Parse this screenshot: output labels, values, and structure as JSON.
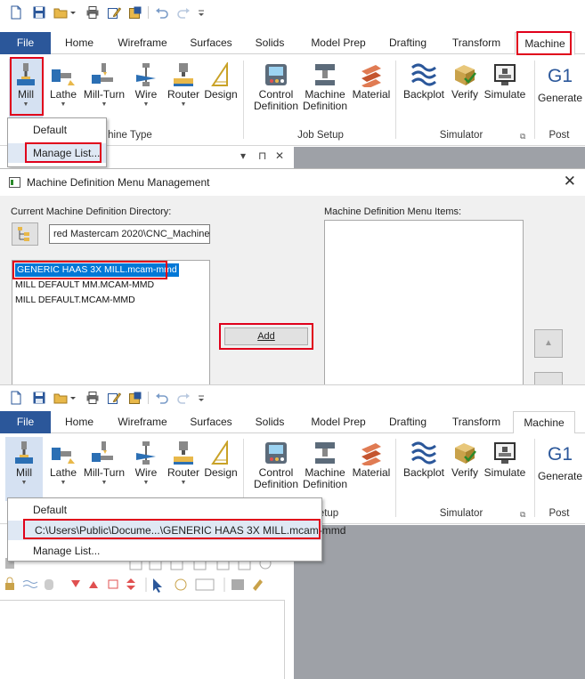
{
  "qat_icons": [
    "new-file-icon",
    "save-icon",
    "open-folder-icon",
    "dropdown-arrow-icon",
    "print-icon",
    "edit-icon",
    "save-as-icon",
    "undo-icon",
    "redo-icon",
    "customize-icon"
  ],
  "tabs": {
    "file": "File",
    "home": "Home",
    "wireframe": "Wireframe",
    "surfaces": "Surfaces",
    "solids": "Solids",
    "model_prep": "Model Prep",
    "drafting": "Drafting",
    "transform": "Transform",
    "machine": "Machine"
  },
  "ribbon": {
    "mill": "Mill",
    "lathe": "Lathe",
    "mill_turn": "Mill-Turn",
    "wire": "Wire",
    "router": "Router",
    "design": "Design",
    "control_line1": "Control",
    "control_line2": "Definition",
    "machine_line1": "Machine",
    "machine_line2": "Definition",
    "material": "Material",
    "backplot": "Backplot",
    "verify": "Verify",
    "simulate": "Simulate",
    "g1": "G1",
    "generate": "Generate"
  },
  "groups": {
    "machine_type": "Machine Type",
    "machine_type_partial": "hine Type",
    "job_setup": "Job Setup",
    "job_setup_partial": "etup",
    "simulator": "Simulator",
    "post": "Post"
  },
  "dropdown_top": {
    "default": "Default",
    "manage": "Manage List..."
  },
  "dropdown_bottom": {
    "default": "Default",
    "recent_path": "C:\\Users\\Public\\Docume...\\GENERIC HAAS 3X MILL.mcam-mmd",
    "manage": "Manage List..."
  },
  "pane_controls": {
    "menu": "▾",
    "pin": "⊓",
    "close": "✕"
  },
  "dialog": {
    "title": "Machine Definition Menu Management",
    "close": "✕",
    "dir_label": "Current Machine Definition Directory:",
    "dir_value": "red Mastercam 2020\\CNC_Machines\\",
    "menu_items_label": "Machine Definition Menu Items:",
    "files": [
      "GENERIC HAAS 3X MILL.mcam-mmd",
      "MILL DEFAULT MM.MCAM-MMD",
      "MILL DEFAULT.MCAM-MMD"
    ],
    "add_label": "Add",
    "up_arrow": "▲"
  },
  "colors": {
    "accent": "#2b579a",
    "highlight_red": "#e0001b",
    "selection_blue": "#0078d7",
    "workspace_gray": "#9ea1a7"
  }
}
